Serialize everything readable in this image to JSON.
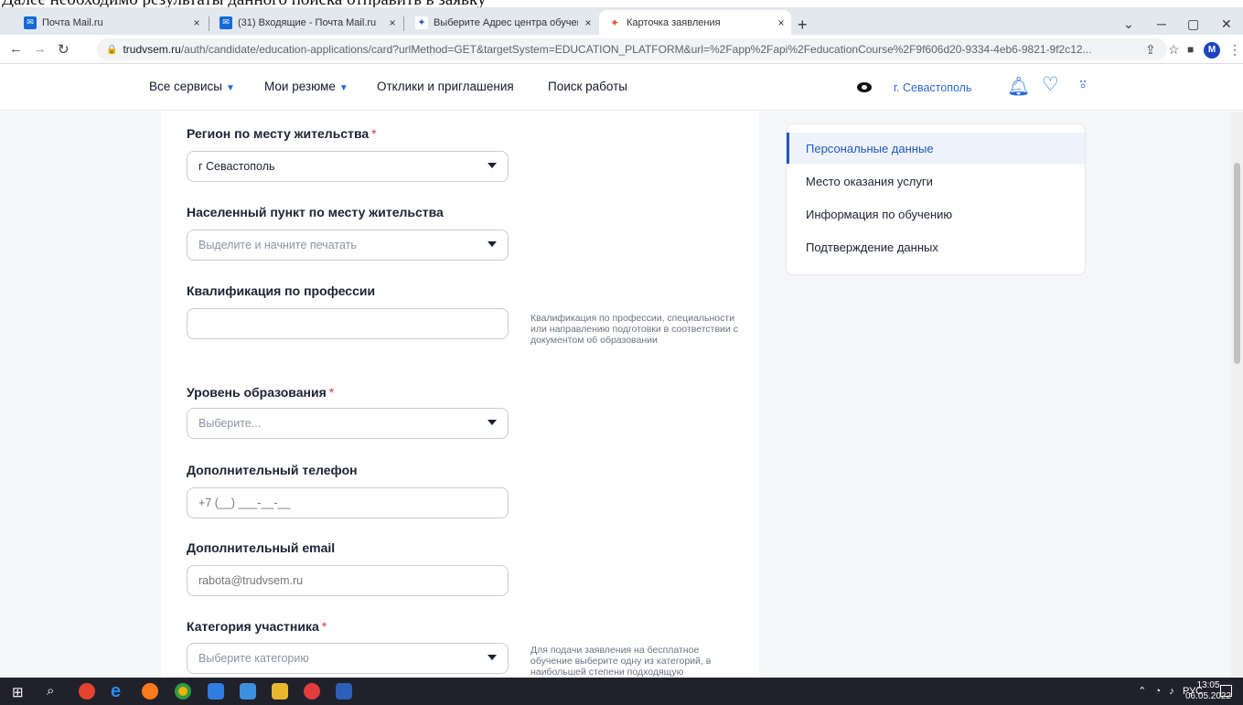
{
  "doc_strip_text": "Далее необходимо результаты данного поиска отправить в заявку",
  "browser": {
    "tabs": [
      {
        "label": "Почта Mail.ru",
        "favicon": "mail-icon"
      },
      {
        "label": "(31) Входящие - Почта Mail.ru",
        "favicon": "mail-icon"
      },
      {
        "label": "Выберите Адрес центра обучен",
        "favicon": "trudvsem-icon"
      },
      {
        "label": "Карточка заявления",
        "favicon": "trudvsem-icon"
      }
    ],
    "close_glyph": "×",
    "new_tab_glyph": "+",
    "url_host": "trudvsem.ru",
    "url_path": "/auth/candidate/education-applications/card?urlMethod=GET&targetSystem=EDUCATION_PLATFORM&url=%2Fapp%2Fapi%2FeducationCourse%2F9f606d20-9334-4eb6-9821-9f2c12...",
    "profile_initial": "M"
  },
  "site_nav": {
    "items": [
      {
        "label": "Все сервисы",
        "caret": true
      },
      {
        "label": "Мои резюме",
        "caret": true
      },
      {
        "label": "Отклики и приглашения",
        "caret": false
      },
      {
        "label": "Поиск работы",
        "caret": false
      }
    ],
    "city": "г. Севастополь"
  },
  "form": {
    "region_label": "Регион по месту жительства",
    "region_value": "г Севастополь",
    "locality_label": "Населенный пункт по месту жительства",
    "locality_placeholder": "Выделите и начните печатать",
    "qualification_label": "Квалификация по профессии",
    "qualification_value": "",
    "qualification_hint": "Квалификация по профессии, специальности или направлению подготовки в соответствии с документом об образовании",
    "education_label": "Уровень образования",
    "education_placeholder": "Выберите...",
    "phone_label": "Дополнительный телефон",
    "phone_placeholder": "+7 (__) ___-__-__",
    "email_label": "Дополнительный email",
    "email_placeholder": "rabota@trudvsem.ru",
    "category_label": "Категория участника",
    "category_placeholder": "Выберите категорию",
    "category_hint": "Для подачи заявления на бесплатное обучение выберите одну из категорий, в наибольшей степени подходящую",
    "required_mark": "*"
  },
  "side_menu": [
    {
      "label": "Персональные данные",
      "active": true
    },
    {
      "label": "Место оказания услуги",
      "active": false
    },
    {
      "label": "Информация по обучению",
      "active": false
    },
    {
      "label": "Подтверждение данных",
      "active": false
    }
  ],
  "taskbar": {
    "lang": "РУС",
    "time": "13:05",
    "date": "06.05.2022"
  },
  "colors": {
    "accent": "#2569d9",
    "required": "#e0333e",
    "active_menu": "#2158b8"
  }
}
